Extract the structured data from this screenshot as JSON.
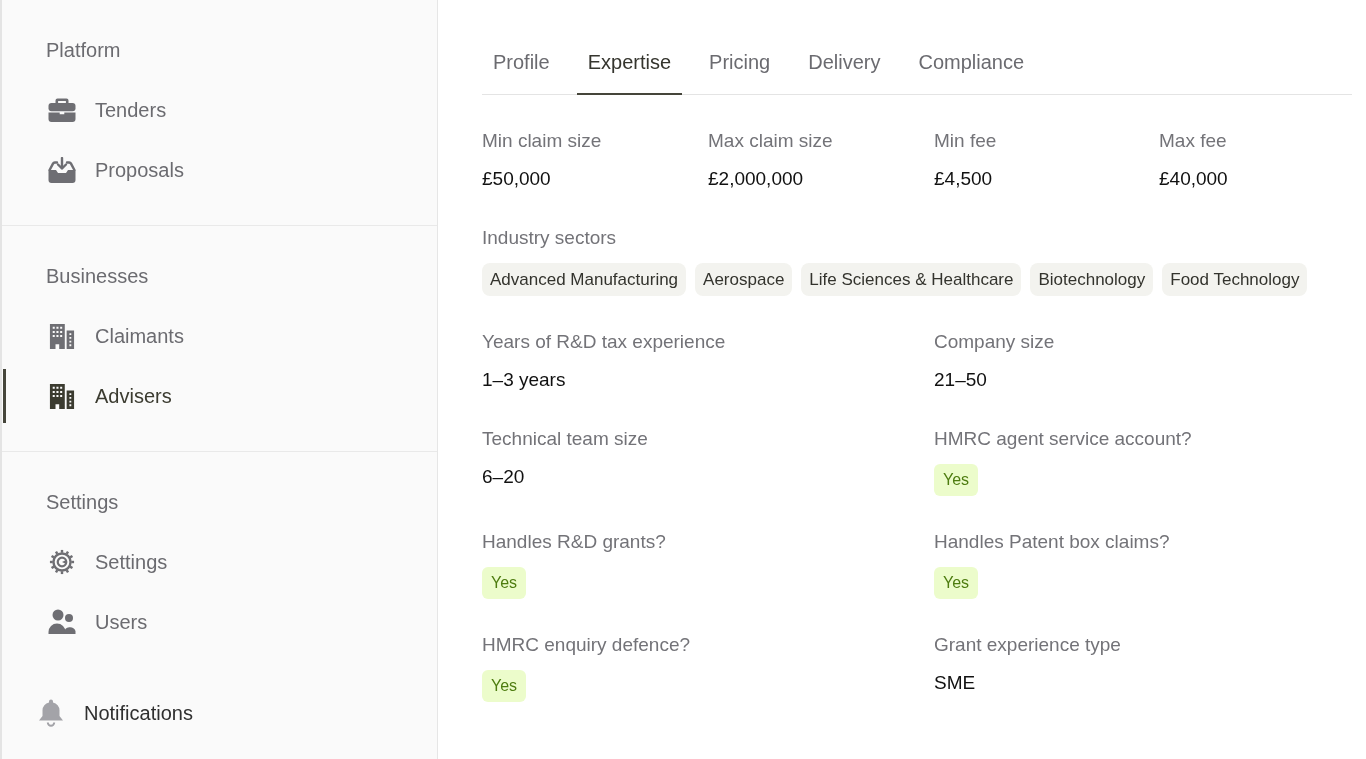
{
  "sidebar": {
    "sections": [
      {
        "heading": "Platform",
        "items": [
          {
            "label": "Tenders",
            "selected": false
          },
          {
            "label": "Proposals",
            "selected": false
          }
        ]
      },
      {
        "heading": "Businesses",
        "items": [
          {
            "label": "Claimants",
            "selected": false
          },
          {
            "label": "Advisers",
            "selected": true
          }
        ]
      },
      {
        "heading": "Settings",
        "items": [
          {
            "label": "Settings",
            "selected": false
          },
          {
            "label": "Users",
            "selected": false
          }
        ]
      }
    ],
    "footer_item": {
      "label": "Notifications"
    }
  },
  "tabs": [
    {
      "label": "Profile",
      "selected": false
    },
    {
      "label": "Expertise",
      "selected": true
    },
    {
      "label": "Pricing",
      "selected": false
    },
    {
      "label": "Delivery",
      "selected": false
    },
    {
      "label": "Compliance",
      "selected": false
    }
  ],
  "fee_fields": [
    {
      "label": "Min claim size",
      "value": "£50,000"
    },
    {
      "label": "Max claim size",
      "value": "£2,000,000"
    },
    {
      "label": "Min fee",
      "value": "£4,500"
    },
    {
      "label": "Max fee",
      "value": "£40,000"
    }
  ],
  "industry_sectors": {
    "label": "Industry sectors",
    "tags": [
      "Advanced Manufacturing",
      "Aerospace",
      "Life Sciences & Healthcare",
      "Biotechnology",
      "Food Technology"
    ]
  },
  "details": [
    {
      "label": "Years of R&D tax experience",
      "kind": "text",
      "value": "1–3 years"
    },
    {
      "label": "Company size",
      "kind": "text",
      "value": "21–50"
    },
    {
      "label": "Technical team size",
      "kind": "text",
      "value": "6–20"
    },
    {
      "label": "HMRC agent service account?",
      "kind": "badge",
      "value": "Yes"
    },
    {
      "label": "Handles R&D grants?",
      "kind": "badge",
      "value": "Yes"
    },
    {
      "label": "Handles Patent box claims?",
      "kind": "badge",
      "value": "Yes"
    },
    {
      "label": "HMRC enquiry defence?",
      "kind": "badge",
      "value": "Yes"
    },
    {
      "label": "Grant experience type",
      "kind": "text",
      "value": "SME"
    }
  ]
}
